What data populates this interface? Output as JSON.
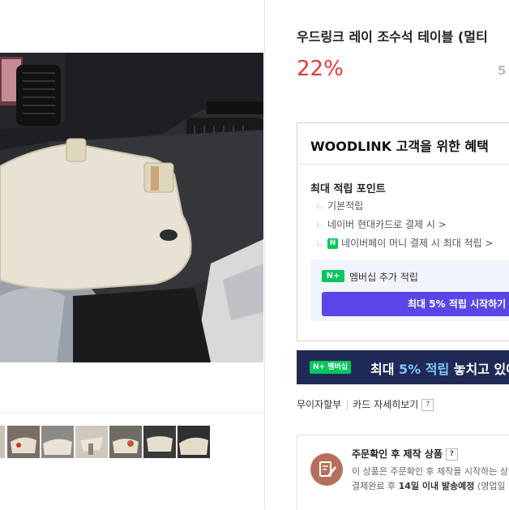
{
  "product": {
    "title": "우드링크 레이 조수석 테이블 (멀티",
    "discount": "22%",
    "original_price_fragment": "5"
  },
  "benefits": {
    "title": "WOODLINK 고객을 위한 혜택",
    "points_heading": "최대 적립 포인트",
    "basic": "기본적립",
    "card_link": "네이버 현대카드로 결제 시 >",
    "npay_badge": "N",
    "npay_link": "네이버페이 머니 결제 시 최대 적립 >",
    "membership_badge": "N+",
    "membership_label": "멤버십 추가 적립",
    "start_button": "최대 5% 적립 시작하기"
  },
  "banner": {
    "badge": "N+ 멤버십",
    "text_prefix": "최대 ",
    "text_highlight": "5% 적립",
    "text_suffix": " 놓치고 있어"
  },
  "installment": {
    "label": "무이자할부",
    "card_link": "카드 자세히보기",
    "help": "?"
  },
  "notice": {
    "title": "주문확인 후 제작 상품",
    "help": "?",
    "line1": "이 상품은 주문확인 후 제작을 시작하는 상",
    "line2_prefix": "결제완료 후 ",
    "line2_bold": "14일 이내 발송예정",
    "line2_suffix": " (영업일"
  },
  "colors": {
    "discount": "#e53935",
    "start_button": "#5a46e6",
    "banner_bg": "#1e2a55",
    "naver_green": "#03c75a",
    "notice_icon": "#b4705a"
  },
  "icons": {
    "notice": "edit-document-icon",
    "npay": "naver-pay-icon"
  }
}
